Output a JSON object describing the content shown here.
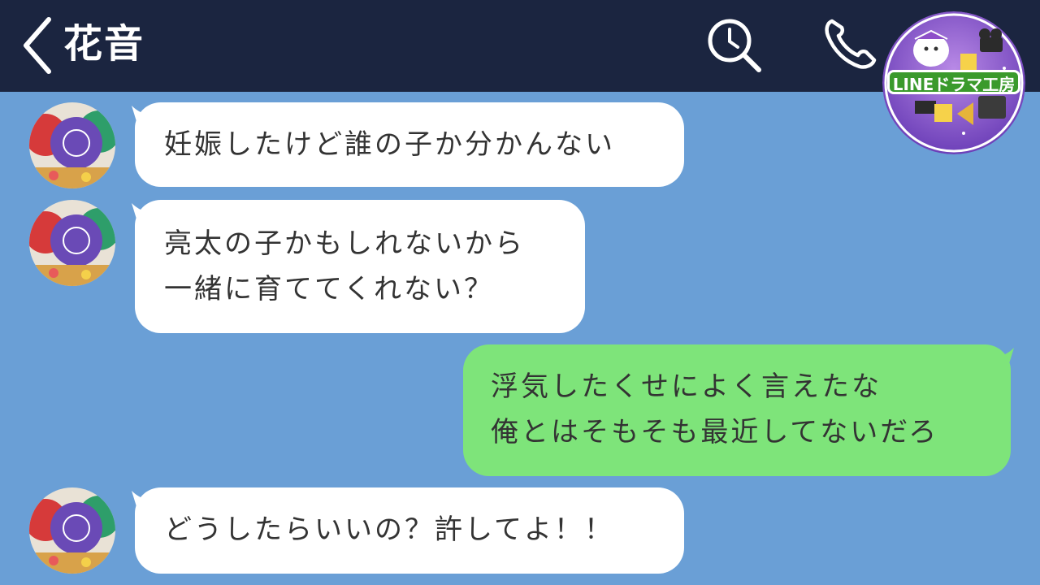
{
  "header": {
    "title": "花音",
    "badge_text": "LINEドラマ工房"
  },
  "messages": [
    {
      "sender": "花音",
      "lines": [
        "妊娠したけど誰の子か分かんない"
      ]
    },
    {
      "sender": "花音",
      "lines": [
        "亮太の子かもしれないから",
        "一緒に育ててくれない？"
      ]
    },
    {
      "sender": "me",
      "lines": [
        "浮気したくせによく言えたな",
        "俺とはそもそも最近してないだろ"
      ]
    },
    {
      "sender": "花音",
      "lines": [
        "どうしたらいいの？許してよ！！"
      ]
    }
  ],
  "colors": {
    "header_bg": "#1b2540",
    "chat_bg": "#6a9fd6",
    "incoming_bubble": "#ffffff",
    "outgoing_bubble": "#7ee47a"
  },
  "icons": [
    "back-chevron-icon",
    "search-icon",
    "phone-icon"
  ]
}
